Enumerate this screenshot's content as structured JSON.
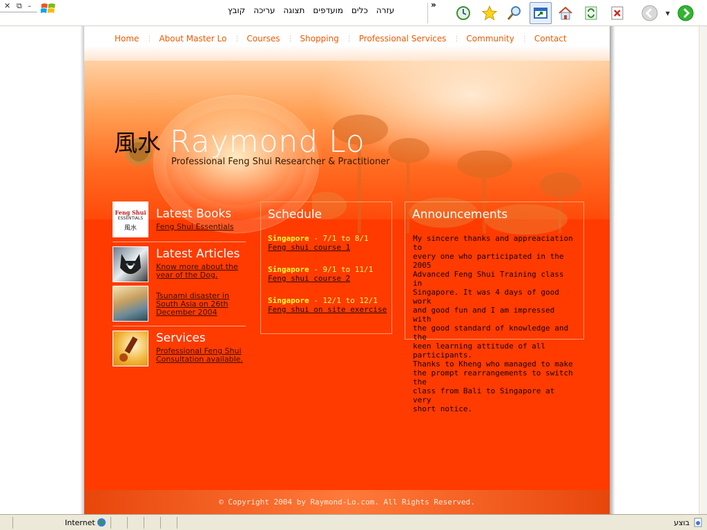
{
  "browser": {
    "window_controls": [
      "✕",
      "⧉",
      "–"
    ],
    "menus": [
      "קובץ",
      "עריכה",
      "תצוגה",
      "מועדפים",
      "כלים",
      "עזרה"
    ],
    "overflow": "»",
    "status_zone": "Internet",
    "status_done": "בוצע"
  },
  "site": {
    "nav": [
      "Home",
      "About Master Lo",
      "Courses",
      "Shopping",
      "Professional Services",
      "Community",
      "Contact"
    ],
    "logo": {
      "glyph": "風水",
      "title": "Raymond Lo",
      "subtitle": "Professional Feng Shui Researcher & Practitioner"
    },
    "latest_books": {
      "title": "Latest Books",
      "thumb_text_1": "Feng Shui",
      "thumb_text_2": "ESSENTIALS",
      "thumb_text_3": "風水",
      "link": "Feng Shui Essentials"
    },
    "latest_articles": {
      "title": "Latest Articles",
      "links": [
        [
          "Know more about the",
          "year of the Dog."
        ],
        [
          "Tsunami disaster in",
          "South Asia on 26th",
          "December 2004"
        ]
      ]
    },
    "services": {
      "title": "Services",
      "link": [
        "Professional Feng Shui",
        "Consultation available."
      ]
    },
    "schedule": {
      "title": "Schedule",
      "items": [
        {
          "city": "Singapore",
          "dates": " - 7/1 to 8/1",
          "link": "Feng shui course 1"
        },
        {
          "city": "Singapore",
          "dates": " - 9/1 to 11/1",
          "link": "Feng shui course 2"
        },
        {
          "city": "Singapore",
          "dates": " - 12/1 to 12/1",
          "link": "Feng shui on site exercise"
        }
      ]
    },
    "announcements": {
      "title": "Announcements",
      "lines": [
        "My sincere thanks and appreaciation to",
        "every one who participated in the 2005",
        "Advanced Feng Shui Training class in",
        "Singapore. It was 4 days of good work",
        "and good fun and I am impressed with",
        "the good standard of knowledge and the",
        "keen learning attitude of all participants.",
        "Thanks to Kheng who managed to make",
        "the prompt rearrangements to switch the",
        "class from Bali to Singapore at very",
        "short notice."
      ]
    },
    "footer": "© Copyright 2004 by Raymond-Lo.com. All Rights Reserved."
  }
}
